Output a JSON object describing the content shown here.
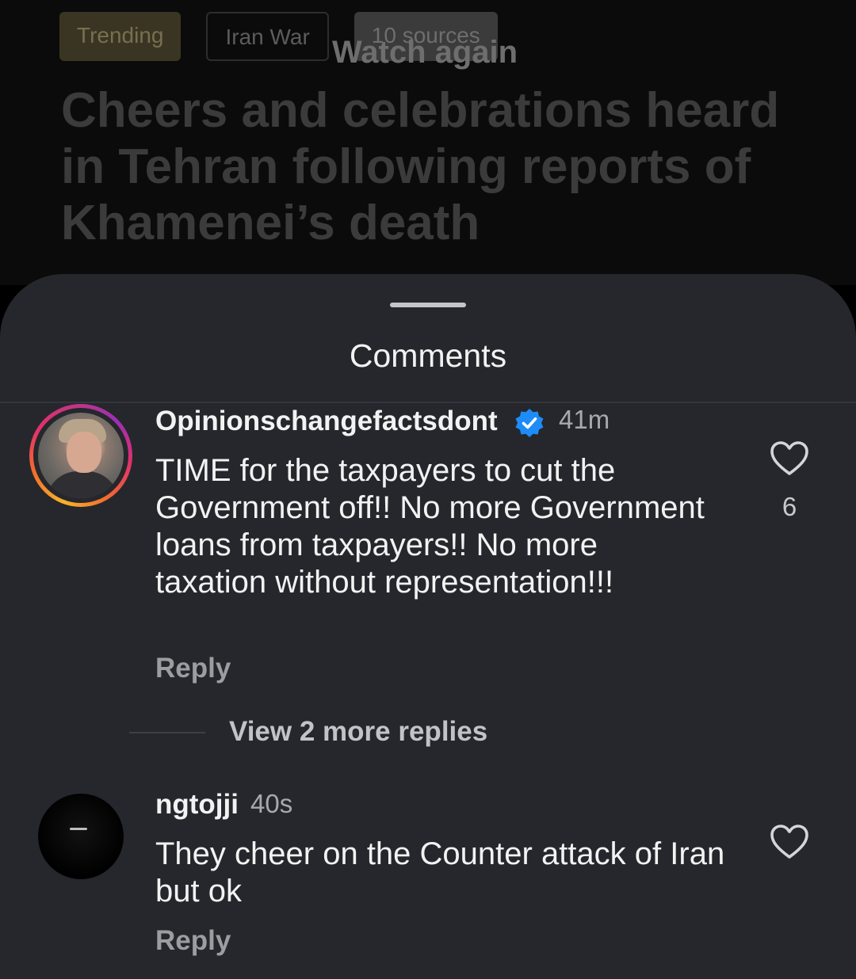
{
  "article": {
    "tags": {
      "trending": "Trending",
      "topic": "Iran War",
      "sources": "10 sources"
    },
    "overlay": "Watch again",
    "headline": "Cheers and celebrations heard in Tehran following reports of Khamenei’s death"
  },
  "comments_sheet": {
    "title": "Comments",
    "comments": [
      {
        "username": "Opinionschangefactsdont",
        "verified": true,
        "time": "41m",
        "text": "TIME for the taxpayers to cut the Government off!! No more Government loans from taxpayers!! No more taxation without representation!!!",
        "reply_label": "Reply",
        "like_count": "6",
        "more_replies_label": "View 2 more replies"
      },
      {
        "username": "ngtojji",
        "time": "40s",
        "text": "They cheer on the Counter attack of Iran but ok",
        "reply_label": "Reply"
      }
    ]
  },
  "colors": {
    "sheet_bg": "#25272c",
    "verified_blue": "#1d8cf8",
    "story_ring": "#e1306c"
  },
  "icons": [
    "verified-badge-icon",
    "heart-icon"
  ]
}
